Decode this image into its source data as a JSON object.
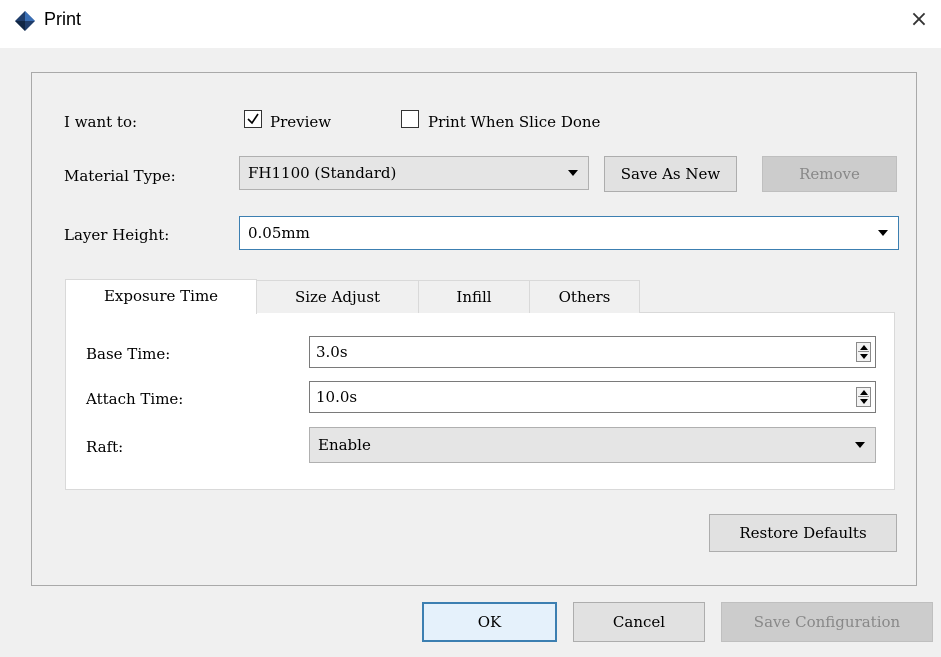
{
  "window": {
    "title": "Print",
    "close_glyph": "×",
    "icon": "diamond-logo-icon"
  },
  "i_want_to": {
    "label": "I want to:",
    "preview": {
      "label": "Preview",
      "checked": true
    },
    "print_when_done": {
      "label": "Print When Slice Done",
      "checked": false
    }
  },
  "material": {
    "label": "Material Type:",
    "value": "FH1100 (Standard)",
    "save_as_new": "Save As New",
    "remove": "Remove"
  },
  "layer_height": {
    "label": "Layer Height:",
    "value": "0.05mm"
  },
  "tabs": [
    {
      "label": "Exposure Time",
      "active": true
    },
    {
      "label": "Size Adjust",
      "active": false
    },
    {
      "label": "Infill",
      "active": false
    },
    {
      "label": "Others",
      "active": false
    }
  ],
  "exposure": {
    "base_time": {
      "label": "Base Time:",
      "value": "3.0s"
    },
    "attach_time": {
      "label": "Attach Time:",
      "value": "10.0s"
    },
    "raft": {
      "label": "Raft:",
      "value": "Enable"
    }
  },
  "restore_defaults": "Restore Defaults",
  "footer": {
    "ok": "OK",
    "cancel": "Cancel",
    "save_config": "Save Configuration"
  },
  "colors": {
    "accent": "#3c7fb1",
    "icon_blue": "#1f3d6b"
  }
}
